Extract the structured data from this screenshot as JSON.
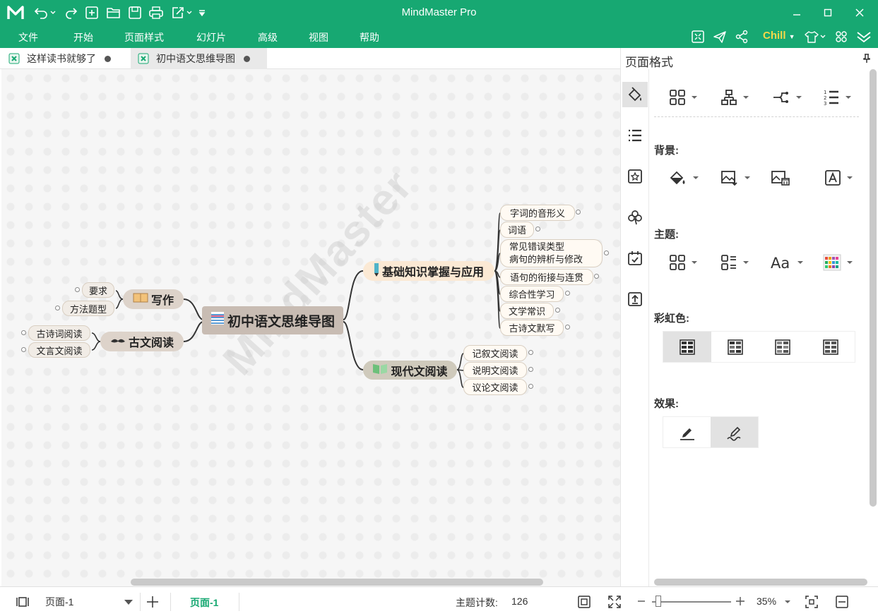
{
  "app": {
    "title": "MindMaster Pro",
    "theme_name": "Chill",
    "accent_color": "#17a872",
    "theme_color": "#f5d84a"
  },
  "menu": {
    "items": [
      "文件",
      "开始",
      "页面样式",
      "幻灯片",
      "高级",
      "视图",
      "帮助"
    ]
  },
  "tabs": [
    {
      "label": "这样读书就够了",
      "active": false
    },
    {
      "label": "初中语文思维导图",
      "active": true
    }
  ],
  "canvas": {
    "watermark": "MindMaster",
    "central": "初中语文思维导图",
    "right_branches": [
      {
        "label": "基础知识掌握与应用",
        "children": [
          "字词的音形义",
          "词语",
          "常见错误类型",
          "病句的辨析与修改",
          "语句的衔接与连贯",
          "综合性学习",
          "文学常识",
          "古诗文默写"
        ]
      },
      {
        "label": "现代文阅读",
        "children": [
          "记叙文阅读",
          "说明文阅读",
          "议论文阅读"
        ]
      }
    ],
    "left_branches": [
      {
        "label": "写作",
        "children": [
          "要求",
          "方法题型"
        ]
      },
      {
        "label": "古文阅读",
        "children": [
          "古诗词阅读",
          "文言文阅读"
        ]
      }
    ]
  },
  "panel": {
    "title": "页面格式",
    "sections": {
      "background": "背景:",
      "theme": "主题:",
      "rainbow": "彩虹色:",
      "effects": "效果:"
    }
  },
  "status": {
    "page_select": "页面-1",
    "page_tab": "页面-1",
    "topic_count_label": "主题计数:",
    "topic_count": "126",
    "zoom": "35%"
  }
}
